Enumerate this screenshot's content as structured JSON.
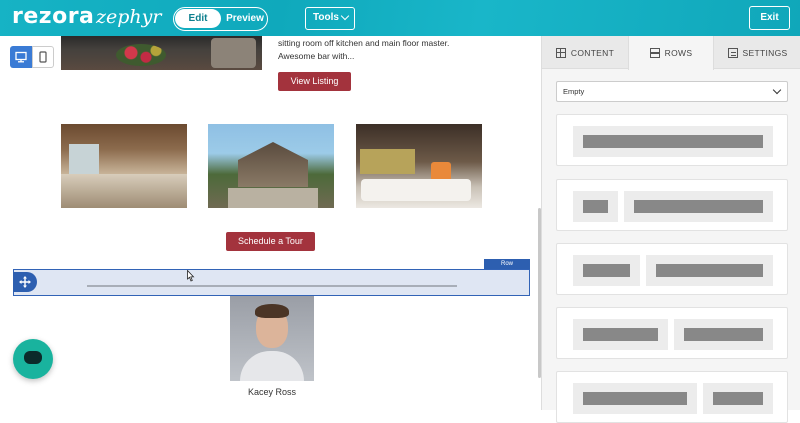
{
  "header": {
    "logo_main": "rezora",
    "logo_sub": "zephyr",
    "edit_label": "Edit",
    "preview_label": "Preview",
    "tools_label": "Tools",
    "exit_label": "Exit"
  },
  "canvas": {
    "listing_text": "sitting room off kitchen and main floor master. Awesome bar with...",
    "view_listing_label": "View Listing",
    "schedule_tour_label": "Schedule a Tour",
    "row_label": "Row",
    "agent_name": "Kacey Ross"
  },
  "panel": {
    "tabs": [
      {
        "label": "CONTENT",
        "icon": "grid-icon"
      },
      {
        "label": "ROWS",
        "icon": "rows-icon"
      },
      {
        "label": "SETTINGS",
        "icon": "settings-doc-icon"
      }
    ],
    "active_tab": "ROWS",
    "row_type_select": "Empty"
  },
  "colors": {
    "brand": "#15b0c2",
    "button_red": "#a3333d",
    "selection_blue": "#2d5fb0",
    "chat_green": "#19b39e"
  }
}
